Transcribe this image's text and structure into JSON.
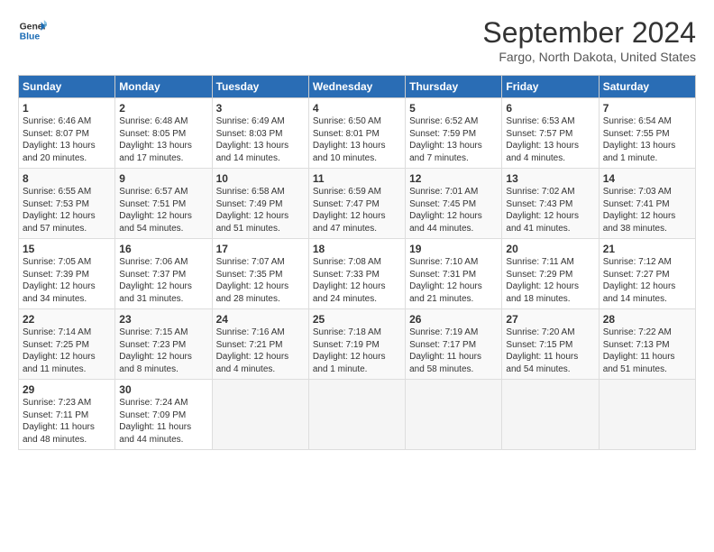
{
  "header": {
    "logo_line1": "General",
    "logo_line2": "Blue",
    "month": "September 2024",
    "location": "Fargo, North Dakota, United States"
  },
  "days_of_week": [
    "Sunday",
    "Monday",
    "Tuesday",
    "Wednesday",
    "Thursday",
    "Friday",
    "Saturday"
  ],
  "weeks": [
    [
      {
        "day": "1",
        "sunrise": "6:46 AM",
        "sunset": "8:07 PM",
        "daylight": "13 hours and 20 minutes."
      },
      {
        "day": "2",
        "sunrise": "6:48 AM",
        "sunset": "8:05 PM",
        "daylight": "13 hours and 17 minutes."
      },
      {
        "day": "3",
        "sunrise": "6:49 AM",
        "sunset": "8:03 PM",
        "daylight": "13 hours and 14 minutes."
      },
      {
        "day": "4",
        "sunrise": "6:50 AM",
        "sunset": "8:01 PM",
        "daylight": "13 hours and 10 minutes."
      },
      {
        "day": "5",
        "sunrise": "6:52 AM",
        "sunset": "7:59 PM",
        "daylight": "13 hours and 7 minutes."
      },
      {
        "day": "6",
        "sunrise": "6:53 AM",
        "sunset": "7:57 PM",
        "daylight": "13 hours and 4 minutes."
      },
      {
        "day": "7",
        "sunrise": "6:54 AM",
        "sunset": "7:55 PM",
        "daylight": "13 hours and 1 minute."
      }
    ],
    [
      {
        "day": "8",
        "sunrise": "6:55 AM",
        "sunset": "7:53 PM",
        "daylight": "12 hours and 57 minutes."
      },
      {
        "day": "9",
        "sunrise": "6:57 AM",
        "sunset": "7:51 PM",
        "daylight": "12 hours and 54 minutes."
      },
      {
        "day": "10",
        "sunrise": "6:58 AM",
        "sunset": "7:49 PM",
        "daylight": "12 hours and 51 minutes."
      },
      {
        "day": "11",
        "sunrise": "6:59 AM",
        "sunset": "7:47 PM",
        "daylight": "12 hours and 47 minutes."
      },
      {
        "day": "12",
        "sunrise": "7:01 AM",
        "sunset": "7:45 PM",
        "daylight": "12 hours and 44 minutes."
      },
      {
        "day": "13",
        "sunrise": "7:02 AM",
        "sunset": "7:43 PM",
        "daylight": "12 hours and 41 minutes."
      },
      {
        "day": "14",
        "sunrise": "7:03 AM",
        "sunset": "7:41 PM",
        "daylight": "12 hours and 38 minutes."
      }
    ],
    [
      {
        "day": "15",
        "sunrise": "7:05 AM",
        "sunset": "7:39 PM",
        "daylight": "12 hours and 34 minutes."
      },
      {
        "day": "16",
        "sunrise": "7:06 AM",
        "sunset": "7:37 PM",
        "daylight": "12 hours and 31 minutes."
      },
      {
        "day": "17",
        "sunrise": "7:07 AM",
        "sunset": "7:35 PM",
        "daylight": "12 hours and 28 minutes."
      },
      {
        "day": "18",
        "sunrise": "7:08 AM",
        "sunset": "7:33 PM",
        "daylight": "12 hours and 24 minutes."
      },
      {
        "day": "19",
        "sunrise": "7:10 AM",
        "sunset": "7:31 PM",
        "daylight": "12 hours and 21 minutes."
      },
      {
        "day": "20",
        "sunrise": "7:11 AM",
        "sunset": "7:29 PM",
        "daylight": "12 hours and 18 minutes."
      },
      {
        "day": "21",
        "sunrise": "7:12 AM",
        "sunset": "7:27 PM",
        "daylight": "12 hours and 14 minutes."
      }
    ],
    [
      {
        "day": "22",
        "sunrise": "7:14 AM",
        "sunset": "7:25 PM",
        "daylight": "12 hours and 11 minutes."
      },
      {
        "day": "23",
        "sunrise": "7:15 AM",
        "sunset": "7:23 PM",
        "daylight": "12 hours and 8 minutes."
      },
      {
        "day": "24",
        "sunrise": "7:16 AM",
        "sunset": "7:21 PM",
        "daylight": "12 hours and 4 minutes."
      },
      {
        "day": "25",
        "sunrise": "7:18 AM",
        "sunset": "7:19 PM",
        "daylight": "12 hours and 1 minute."
      },
      {
        "day": "26",
        "sunrise": "7:19 AM",
        "sunset": "7:17 PM",
        "daylight": "11 hours and 58 minutes."
      },
      {
        "day": "27",
        "sunrise": "7:20 AM",
        "sunset": "7:15 PM",
        "daylight": "11 hours and 54 minutes."
      },
      {
        "day": "28",
        "sunrise": "7:22 AM",
        "sunset": "7:13 PM",
        "daylight": "11 hours and 51 minutes."
      }
    ],
    [
      {
        "day": "29",
        "sunrise": "7:23 AM",
        "sunset": "7:11 PM",
        "daylight": "11 hours and 48 minutes."
      },
      {
        "day": "30",
        "sunrise": "7:24 AM",
        "sunset": "7:09 PM",
        "daylight": "11 hours and 44 minutes."
      },
      null,
      null,
      null,
      null,
      null
    ]
  ]
}
